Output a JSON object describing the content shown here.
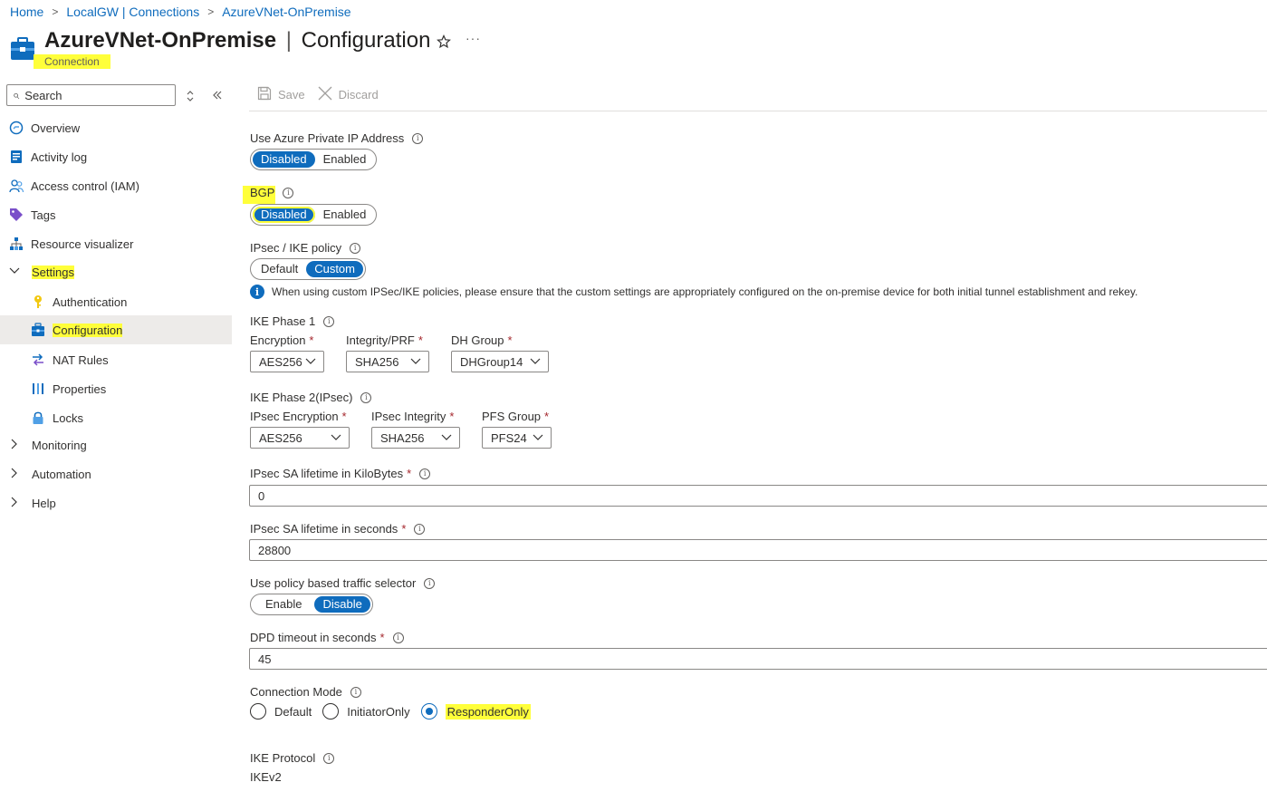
{
  "breadcrumb": {
    "items": [
      "Home",
      "LocalGW | Connections",
      "AzureVNet-OnPremise"
    ],
    "separator": ">"
  },
  "header": {
    "resource_name": "AzureVNet-OnPremise",
    "pipe": "|",
    "section": "Configuration",
    "subtitle": "Connection",
    "more": "···"
  },
  "sidebar": {
    "search_placeholder": "Search",
    "items": [
      {
        "label": "Overview",
        "icon": "overview-icon"
      },
      {
        "label": "Activity log",
        "icon": "activity-log-icon"
      },
      {
        "label": "Access control (IAM)",
        "icon": "people-icon"
      },
      {
        "label": "Tags",
        "icon": "tag-icon"
      },
      {
        "label": "Resource visualizer",
        "icon": "hierarchy-icon"
      },
      {
        "label": "Settings",
        "icon": "chevron-down-icon",
        "expanded": true
      },
      {
        "label": "Authentication",
        "icon": "key-icon"
      },
      {
        "label": "Configuration",
        "icon": "toolbox-icon",
        "selected": true
      },
      {
        "label": "NAT Rules",
        "icon": "nat-icon"
      },
      {
        "label": "Properties",
        "icon": "properties-icon"
      },
      {
        "label": "Locks",
        "icon": "lock-icon"
      },
      {
        "label": "Monitoring",
        "icon": "chevron-right-icon"
      },
      {
        "label": "Automation",
        "icon": "chevron-right-icon"
      },
      {
        "label": "Help",
        "icon": "chevron-right-icon"
      }
    ]
  },
  "toolbar": {
    "save_label": "Save",
    "discard_label": "Discard"
  },
  "form": {
    "private_ip": {
      "label": "Use Azure Private IP Address",
      "options": [
        "Disabled",
        "Enabled"
      ],
      "selected": "Disabled"
    },
    "bgp": {
      "label": "BGP",
      "options": [
        "Disabled",
        "Enabled"
      ],
      "selected": "Disabled"
    },
    "ipsec_policy": {
      "label": "IPsec / IKE policy",
      "options": [
        "Default",
        "Custom"
      ],
      "selected": "Custom"
    },
    "policy_note": "When using custom IPSec/IKE policies, please ensure that the custom settings are appropriately configured on the on-premise device for both initial tunnel establishment and rekey.",
    "ike_phase1": {
      "label": "IKE Phase 1",
      "encryption": {
        "label": "Encryption",
        "value": "AES256"
      },
      "integrity": {
        "label": "Integrity/PRF",
        "value": "SHA256"
      },
      "dh_group": {
        "label": "DH Group",
        "value": "DHGroup14"
      }
    },
    "ike_phase2": {
      "label": "IKE Phase 2(IPsec)",
      "encryption": {
        "label": "IPsec Encryption",
        "value": "AES256"
      },
      "integrity": {
        "label": "IPsec Integrity",
        "value": "SHA256"
      },
      "pfs_group": {
        "label": "PFS Group",
        "value": "PFS24"
      }
    },
    "sa_kb": {
      "label": "IPsec SA lifetime in KiloBytes",
      "value": "0"
    },
    "sa_seconds": {
      "label": "IPsec SA lifetime in seconds",
      "value": "28800"
    },
    "traffic_selector": {
      "label": "Use policy based traffic selector",
      "options": [
        "Enable",
        "Disable"
      ],
      "selected": "Disable"
    },
    "dpd": {
      "label": "DPD timeout in seconds",
      "value": "45"
    },
    "connection_mode": {
      "label": "Connection Mode",
      "options": [
        "Default",
        "InitiatorOnly",
        "ResponderOnly"
      ],
      "selected": "ResponderOnly"
    },
    "ike_protocol": {
      "label": "IKE Protocol",
      "value": "IKEv2"
    },
    "required_mark": "*"
  },
  "colors": {
    "accent": "#0f6cbd",
    "highlight": "#ffff3a",
    "required": "#a4262c"
  }
}
